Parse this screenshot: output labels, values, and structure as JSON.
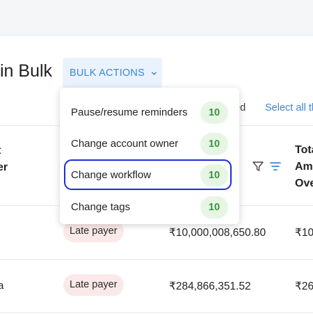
{
  "page": {
    "title_partial": "in Bulk"
  },
  "bulk_actions": {
    "label": "BULK ACTIONS"
  },
  "selection": {
    "selected_partial": "ted",
    "select_all_partial": "Select all th"
  },
  "table": {
    "header_left_partial": [
      "t",
      "er"
    ],
    "header_right_partial": [
      "Tota",
      "Am",
      "Ove"
    ],
    "rows": [
      {
        "left_partial": "",
        "status": "Late payer",
        "amount": "₹10,000,008,650.80",
        "next_partial": "₹10,"
      },
      {
        "left_partial": "a",
        "status": "Late payer",
        "amount": "₹284,866,351.52",
        "next_partial": "₹26"
      }
    ]
  },
  "menu": {
    "items": [
      {
        "label": "Pause/resume reminders",
        "count": "10"
      },
      {
        "label": "Change account owner",
        "count": "10"
      },
      {
        "label": "Change workflow",
        "count": "10"
      },
      {
        "label": "Change tags",
        "count": "10"
      }
    ]
  },
  "colors": {
    "accent": "#3a86d6",
    "focus": "#1a2ed6",
    "badge_green_bg": "#e7f5e5",
    "badge_green_text": "#3b9440",
    "badge_red_bg": "#fbe9e9"
  },
  "icons": [
    "chevron-down-icon",
    "filter-icon",
    "sort-icon"
  ]
}
